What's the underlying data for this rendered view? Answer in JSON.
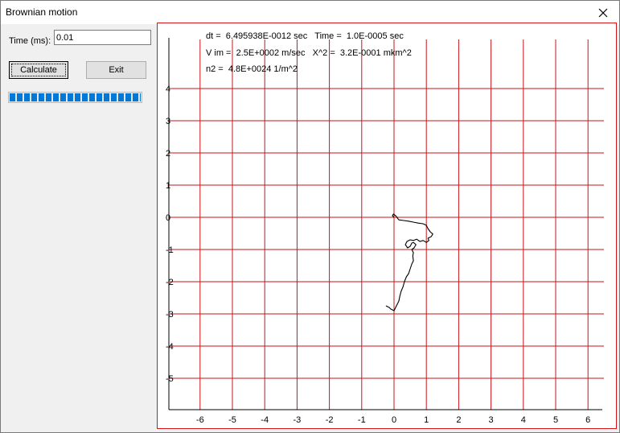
{
  "window": {
    "title": "Brownian motion",
    "close_icon": "close-icon"
  },
  "controls": {
    "time_label": "Time (ms):",
    "time_value": "0.01",
    "calculate_label": "Calculate",
    "exit_label": "Exit",
    "progress_fraction": 1.0
  },
  "stats": {
    "line1": "dt =  6.495938E-0012 sec   Time =  1.0E-0005 sec",
    "line2": "V im =  2.5E+0002 m/sec   X^2 =  3.2E-0001 mkm^2",
    "line3": "n2 =  4.8E+0024 1/m^2"
  },
  "chart_data": {
    "type": "line",
    "xlim": [
      -7,
      6.5
    ],
    "ylim": [
      -6,
      4.5
    ],
    "x_ticks": [
      -6,
      -5,
      -4,
      -3,
      -2,
      -1,
      0,
      1,
      2,
      3,
      4,
      5,
      6
    ],
    "y_ticks": [
      4,
      3,
      2,
      1,
      0,
      -1,
      -2,
      -3,
      -4,
      -5
    ],
    "grid": true,
    "grid_color": "#c8151b",
    "axis_color": "#000000",
    "series": [
      {
        "color": "#000000",
        "points": [
          [
            0.0,
            0.0
          ],
          [
            -0.05,
            0.05
          ],
          [
            -0.02,
            0.1
          ],
          [
            0.05,
            0.05
          ],
          [
            0.15,
            -0.08
          ],
          [
            0.3,
            -0.1
          ],
          [
            0.45,
            -0.12
          ],
          [
            0.6,
            -0.15
          ],
          [
            0.75,
            -0.18
          ],
          [
            0.9,
            -0.2
          ],
          [
            1.0,
            -0.25
          ],
          [
            1.05,
            -0.35
          ],
          [
            1.12,
            -0.45
          ],
          [
            1.2,
            -0.52
          ],
          [
            1.15,
            -0.6
          ],
          [
            1.05,
            -0.65
          ],
          [
            1.08,
            -0.72
          ],
          [
            1.0,
            -0.78
          ],
          [
            0.9,
            -0.72
          ],
          [
            0.8,
            -0.75
          ],
          [
            0.7,
            -0.68
          ],
          [
            0.6,
            -0.72
          ],
          [
            0.5,
            -0.7
          ],
          [
            0.4,
            -0.75
          ],
          [
            0.35,
            -0.85
          ],
          [
            0.42,
            -0.95
          ],
          [
            0.5,
            -0.9
          ],
          [
            0.55,
            -0.8
          ],
          [
            0.6,
            -0.78
          ],
          [
            0.68,
            -0.85
          ],
          [
            0.62,
            -0.95
          ],
          [
            0.55,
            -1.0
          ],
          [
            0.6,
            -1.1
          ],
          [
            0.58,
            -1.2
          ],
          [
            0.6,
            -1.35
          ],
          [
            0.55,
            -1.45
          ],
          [
            0.5,
            -1.6
          ],
          [
            0.45,
            -1.75
          ],
          [
            0.38,
            -1.85
          ],
          [
            0.32,
            -2.0
          ],
          [
            0.28,
            -2.15
          ],
          [
            0.22,
            -2.3
          ],
          [
            0.18,
            -2.45
          ],
          [
            0.15,
            -2.6
          ],
          [
            0.1,
            -2.7
          ],
          [
            0.05,
            -2.8
          ],
          [
            0.0,
            -2.9
          ],
          [
            -0.1,
            -2.85
          ],
          [
            -0.15,
            -2.8
          ],
          [
            -0.25,
            -2.75
          ]
        ]
      }
    ]
  }
}
